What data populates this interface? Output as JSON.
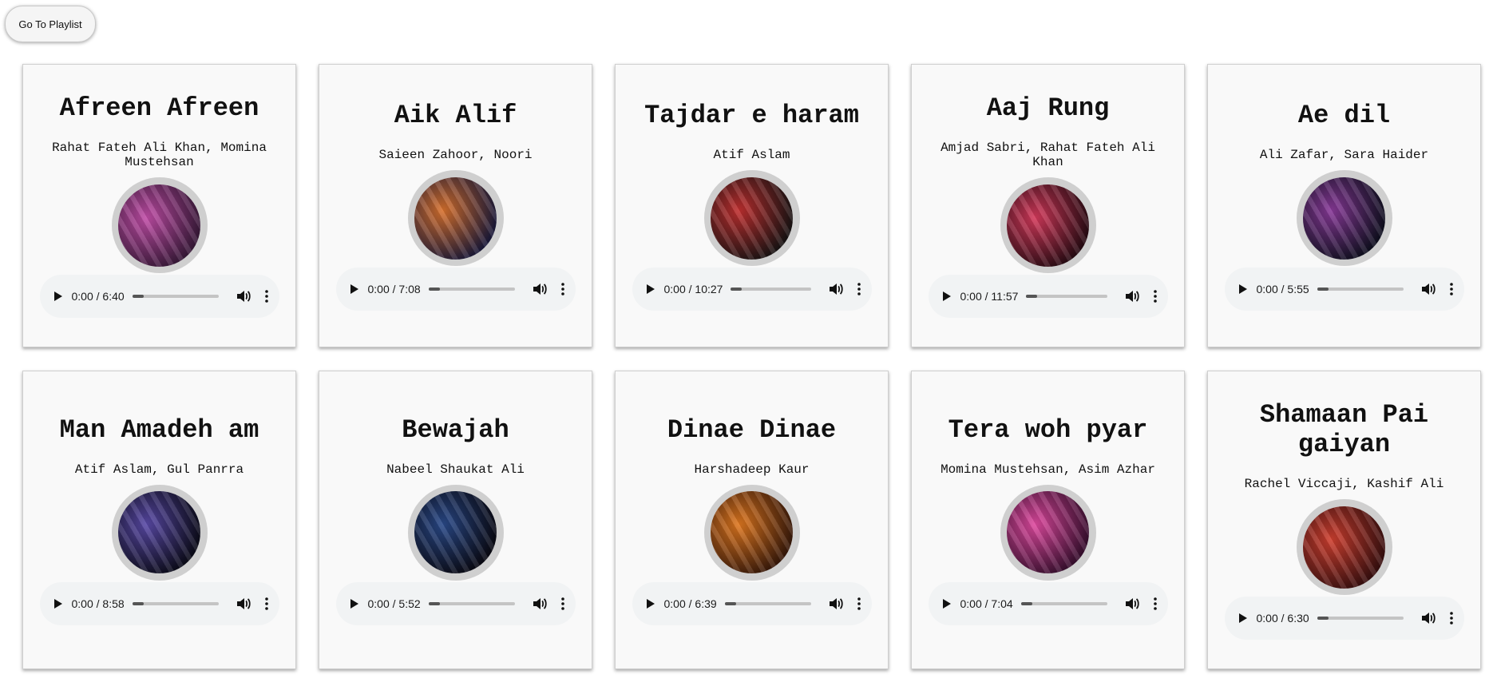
{
  "header": {
    "playlist_button_label": "Go To Playlist"
  },
  "songs": [
    {
      "title": "Afreen Afreen",
      "artists": "Rahat Fateh Ali Khan, Momina Mustehsan",
      "time": "0:00 / 6:40",
      "thumb_colors": [
        "#c24ea8",
        "#3a1a3a"
      ]
    },
    {
      "title": "Aik Alif",
      "artists": "Saieen Zahoor, Noori",
      "time": "0:00 / 7:08",
      "thumb_colors": [
        "#d9722e",
        "#1c1a3a"
      ]
    },
    {
      "title": "Tajdar e haram",
      "artists": "Atif Aslam",
      "time": "0:00 / 10:27",
      "thumb_colors": [
        "#c23030",
        "#1a1414"
      ]
    },
    {
      "title": "Aaj Rung",
      "artists": "Amjad Sabri, Rahat Fateh Ali Khan",
      "time": "0:00 / 11:57",
      "thumb_colors": [
        "#d63a5c",
        "#2a0c14"
      ]
    },
    {
      "title": "Ae dil",
      "artists": "Ali Zafar, Sara Haider",
      "time": "0:00 / 5:55",
      "thumb_colors": [
        "#8a3a9a",
        "#101020"
      ]
    },
    {
      "title": "Man Amadeh am",
      "artists": "Atif Aslam, Gul Panrra",
      "time": "0:00 / 8:58",
      "thumb_colors": [
        "#5a4aa8",
        "#0c0c1a"
      ]
    },
    {
      "title": "Bewajah",
      "artists": "Nabeel Shaukat Ali",
      "time": "0:00 / 5:52",
      "thumb_colors": [
        "#2a4a8a",
        "#0a0a14"
      ]
    },
    {
      "title": "Dinae Dinae",
      "artists": "Harshadeep Kaur",
      "time": "0:00 / 6:39",
      "thumb_colors": [
        "#e07820",
        "#3a1a0a"
      ]
    },
    {
      "title": "Tera woh pyar",
      "artists": "Momina Mustehsan, Asim Azhar",
      "time": "0:00 / 7:04",
      "thumb_colors": [
        "#e04aa0",
        "#3a1030"
      ]
    },
    {
      "title": "Shamaan Pai gaiyan",
      "artists": "Rachel Viccaji, Kashif Ali",
      "time": "0:00 / 6:30",
      "thumb_colors": [
        "#d04030",
        "#3a1010"
      ]
    }
  ]
}
